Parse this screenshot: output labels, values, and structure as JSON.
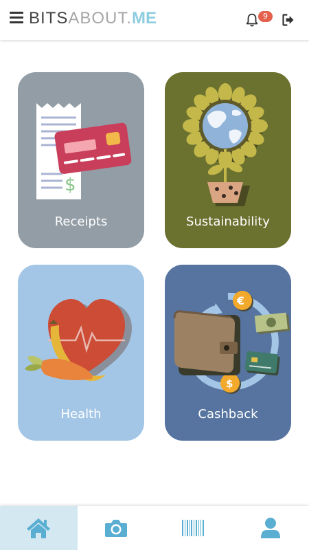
{
  "header": {
    "logo_part1": "BITS",
    "logo_part2": "ABOUT.",
    "logo_part3": "ME",
    "notification_count": "9",
    "menu_icon": "hamburger-menu-icon",
    "bell_icon": "bell-icon",
    "logout_icon": "logout-icon"
  },
  "cards": [
    {
      "label": "Receipts",
      "color": "#939da6"
    },
    {
      "label": "Sustainability",
      "color": "#6b712f"
    },
    {
      "label": "Health",
      "color": "#a4c6e6"
    },
    {
      "label": "Cashback",
      "color": "#56749f"
    }
  ],
  "nav": {
    "items": [
      {
        "icon": "home-icon",
        "active": true
      },
      {
        "icon": "camera-icon",
        "active": false
      },
      {
        "icon": "barcode-icon",
        "active": false
      },
      {
        "icon": "user-icon",
        "active": false
      }
    ],
    "accent": "#5aaed1"
  }
}
